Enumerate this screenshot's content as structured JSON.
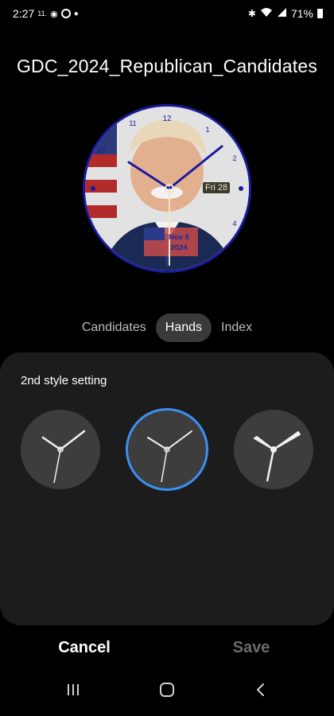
{
  "status_bar": {
    "time": "2:27",
    "small_label": "11.",
    "battery": "71%"
  },
  "title": "GDC_2024_Republican_Candidates",
  "watch_face": {
    "date_badge": "Fri 28",
    "flag_date_line1": "Nov 5",
    "flag_date_line2": "2024",
    "accent_color": "#1a1aa0"
  },
  "tabs": [
    {
      "label": "Candidates",
      "active": false
    },
    {
      "label": "Hands",
      "active": true
    },
    {
      "label": "Index",
      "active": false
    }
  ],
  "panel": {
    "title": "2nd style setting",
    "options": [
      {
        "name": "hand-style-1",
        "selected": false
      },
      {
        "name": "hand-style-2",
        "selected": true
      },
      {
        "name": "hand-style-3",
        "selected": false
      }
    ]
  },
  "actions": {
    "cancel": "Cancel",
    "save": "Save"
  },
  "nav_icons": [
    "recent-apps-icon",
    "home-icon",
    "back-icon"
  ],
  "colors": {
    "selected_ring": "#3c8ff5",
    "panel_bg": "#1c1c1c"
  }
}
